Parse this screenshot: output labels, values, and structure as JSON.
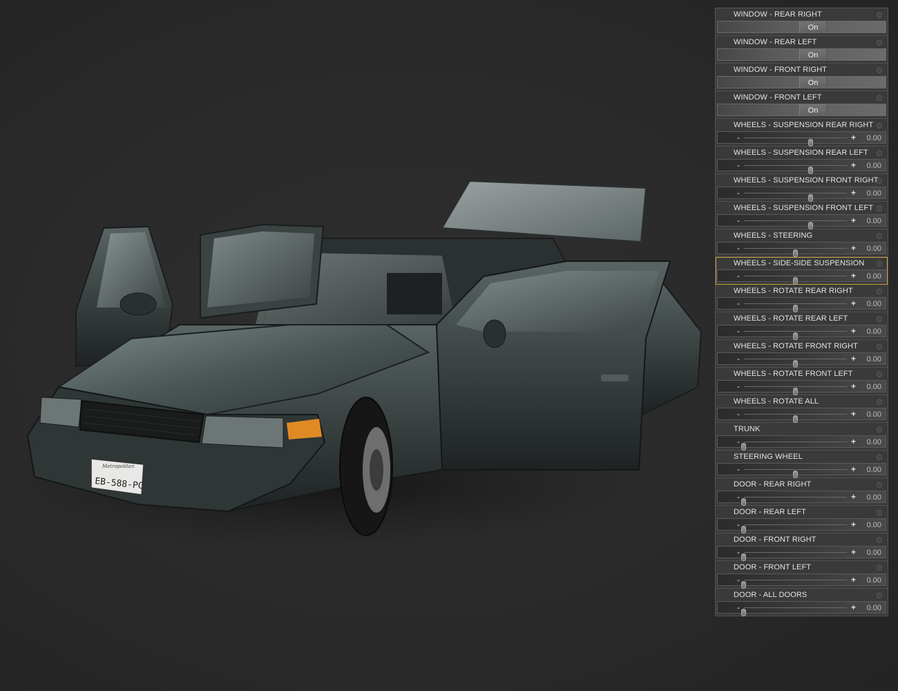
{
  "scene": {
    "plate_text": "EB-588-PC",
    "plate_region": "Metropolitan",
    "car_color": "#3b4242"
  },
  "panel": {
    "rows": [
      {
        "label": "WINDOW - REAR RIGHT",
        "kind": "toggle",
        "value": "On"
      },
      {
        "label": "WINDOW - REAR LEFT",
        "kind": "toggle",
        "value": "On"
      },
      {
        "label": "WINDOW - FRONT RIGHT",
        "kind": "toggle",
        "value": "On"
      },
      {
        "label": "WINDOW - FRONT LEFT",
        "kind": "toggle",
        "value": "On"
      },
      {
        "label": "WHEELS - SUSPENSION REAR RIGHT",
        "kind": "slider",
        "value": "0.00",
        "level": 0.65
      },
      {
        "label": "WHEELS - SUSPENSION REAR LEFT",
        "kind": "slider",
        "value": "0.00",
        "level": 0.65
      },
      {
        "label": "WHEELS - SUSPENSION FRONT RIGHT",
        "kind": "slider",
        "value": "0.00",
        "level": 0.65
      },
      {
        "label": "WHEELS - SUSPENSION FRONT LEFT",
        "kind": "slider",
        "value": "0.00",
        "level": 0.65
      },
      {
        "label": "WHEELS - STEERING",
        "kind": "slider",
        "value": "0.00",
        "level": 0.5
      },
      {
        "label": "WHEELS - SIDE-SIDE SUSPENSION",
        "kind": "slider",
        "value": "0.00",
        "level": 0.5,
        "selected": true
      },
      {
        "label": "WHEELS - ROTATE REAR RIGHT",
        "kind": "slider",
        "value": "0.00",
        "level": 0.5
      },
      {
        "label": "WHEELS - ROTATE REAR LEFT",
        "kind": "slider",
        "value": "0.00",
        "level": 0.5
      },
      {
        "label": "WHEELS - ROTATE FRONT RIGHT",
        "kind": "slider",
        "value": "0.00",
        "level": 0.5
      },
      {
        "label": "WHEELS - ROTATE FRONT LEFT",
        "kind": "slider",
        "value": "0.00",
        "level": 0.5
      },
      {
        "label": "WHEELS - ROTATE ALL",
        "kind": "slider",
        "value": "0.00",
        "level": 0.5
      },
      {
        "label": "TRUNK",
        "kind": "slider",
        "value": "0.00",
        "level": 0.0
      },
      {
        "label": "STEERING WHEEL",
        "kind": "slider",
        "value": "0.00",
        "level": 0.5
      },
      {
        "label": "DOOR - REAR RIGHT",
        "kind": "slider",
        "value": "0.00",
        "level": 0.0
      },
      {
        "label": "DOOR - REAR LEFT",
        "kind": "slider",
        "value": "0.00",
        "level": 0.0
      },
      {
        "label": "DOOR - FRONT RIGHT",
        "kind": "slider",
        "value": "0.00",
        "level": 0.0
      },
      {
        "label": "DOOR - FRONT LEFT",
        "kind": "slider",
        "value": "0.00",
        "level": 0.0
      },
      {
        "label": "DOOR - ALL DOORS",
        "kind": "slider",
        "value": "0.00",
        "level": 0.0
      }
    ],
    "accent_selected": "#c8a23c"
  }
}
